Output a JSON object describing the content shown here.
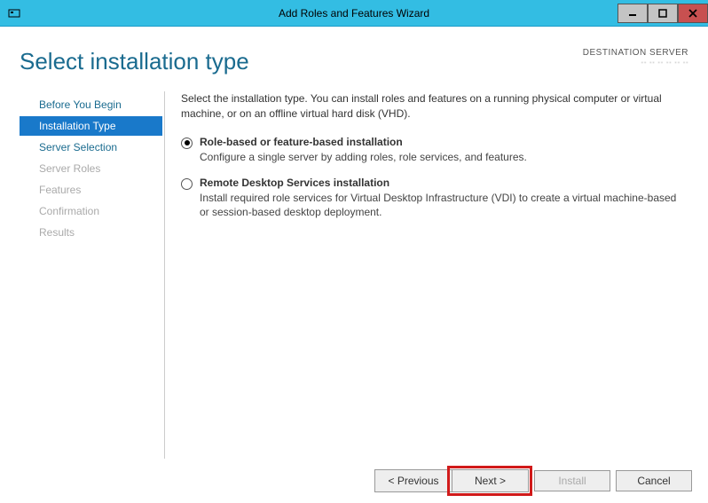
{
  "window": {
    "title": "Add Roles and Features Wizard"
  },
  "header": {
    "page_title": "Select installation type",
    "destination_label": "DESTINATION SERVER",
    "destination_value": "·· ·· ·· ·· ·· ··"
  },
  "sidebar": {
    "items": [
      {
        "label": "Before You Begin",
        "state": "enabled"
      },
      {
        "label": "Installation Type",
        "state": "active"
      },
      {
        "label": "Server Selection",
        "state": "enabled"
      },
      {
        "label": "Server Roles",
        "state": "disabled"
      },
      {
        "label": "Features",
        "state": "disabled"
      },
      {
        "label": "Confirmation",
        "state": "disabled"
      },
      {
        "label": "Results",
        "state": "disabled"
      }
    ]
  },
  "main": {
    "intro": "Select the installation type. You can install roles and features on a running physical computer or virtual machine, or on an offline virtual hard disk (VHD).",
    "options": [
      {
        "title": "Role-based or feature-based installation",
        "desc": "Configure a single server by adding roles, role services, and features.",
        "selected": true
      },
      {
        "title": "Remote Desktop Services installation",
        "desc": "Install required role services for Virtual Desktop Infrastructure (VDI) to create a virtual machine-based or session-based desktop deployment.",
        "selected": false
      }
    ]
  },
  "footer": {
    "previous": "< Previous",
    "next": "Next >",
    "install": "Install",
    "cancel": "Cancel"
  }
}
